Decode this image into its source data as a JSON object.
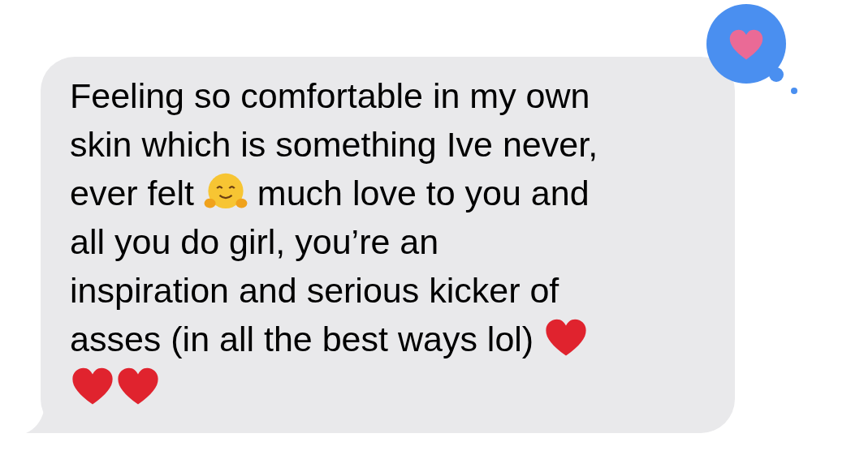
{
  "message": {
    "lines": [
      [
        {
          "kind": "text",
          "text": "Feeling so comfortable in my own"
        }
      ],
      [
        {
          "kind": "text",
          "text": "skin which is something Ive never,"
        }
      ],
      [
        {
          "kind": "text",
          "text": "ever felt "
        },
        {
          "kind": "hug"
        },
        {
          "kind": "text",
          "text": " much love to you and"
        }
      ],
      [
        {
          "kind": "text",
          "text": "all you do girl, you’re an"
        }
      ],
      [
        {
          "kind": "text",
          "text": "inspiration and serious kicker of"
        }
      ],
      [
        {
          "kind": "text",
          "text": "asses (in all the best ways lol) "
        },
        {
          "kind": "heart"
        }
      ],
      [
        {
          "kind": "heart"
        },
        {
          "kind": "heart"
        }
      ]
    ],
    "tapback": {
      "kind": "heart"
    }
  }
}
